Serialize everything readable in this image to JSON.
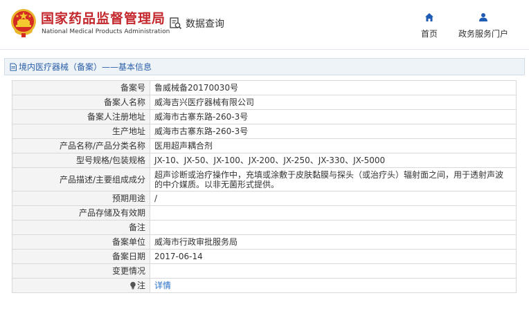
{
  "header": {
    "brand_cn": "国家药品监督管理局",
    "brand_en": "National Medical Products Administration",
    "query_label": "数据查询",
    "nav": {
      "home": "首页",
      "portal": "政务服务门户"
    },
    "icons": {
      "emblem": "national-emblem-icon",
      "query": "search-document-icon",
      "home": "home-icon",
      "portal": "user-icon"
    },
    "colors": {
      "brand": "#c3262b",
      "nav_icon": "#1f5bb5",
      "link": "#2a6fc9",
      "title_text": "#2a5fa8"
    }
  },
  "titlebar": {
    "text": "境内医疗器械（备案）——基本信息"
  },
  "record": {
    "rows": [
      {
        "label": "备案号",
        "value": "鲁威械备20170030号"
      },
      {
        "label": "备案人名称",
        "value": "威海吉兴医疗器械有限公司"
      },
      {
        "label": "备案人注册地址",
        "value": "威海市古寨东路-260-3号"
      },
      {
        "label": "生产地址",
        "value": "威海市古寨东路-260-3号"
      },
      {
        "label": "产品名称/产品分类名称",
        "value": "医用超声耦合剂"
      },
      {
        "label": "型号规格/包装规格",
        "value": "JX-10、JX-50、JX-100、JX-200、JX-250、JX-330、JX-5000"
      },
      {
        "label": "产品描述/主要组成成分",
        "value": "超声诊断或治疗操作中，充填或涂敷于皮肤黏膜与探头（或治疗头）辐射面之间，用于透射声波的中介媒质。以非无菌形式提供。"
      },
      {
        "label": "预期用途",
        "value": "/"
      },
      {
        "label": "产品存储及有效期",
        "value": ""
      },
      {
        "label": "备注",
        "value": ""
      },
      {
        "label": "备案单位",
        "value": "威海市行政审批服务局"
      },
      {
        "label": "备案日期",
        "value": "2017-06-14"
      },
      {
        "label": "变更情况",
        "value": ""
      }
    ],
    "note": {
      "label": "注",
      "link": "详情",
      "icon": "lightbulb-icon"
    }
  }
}
